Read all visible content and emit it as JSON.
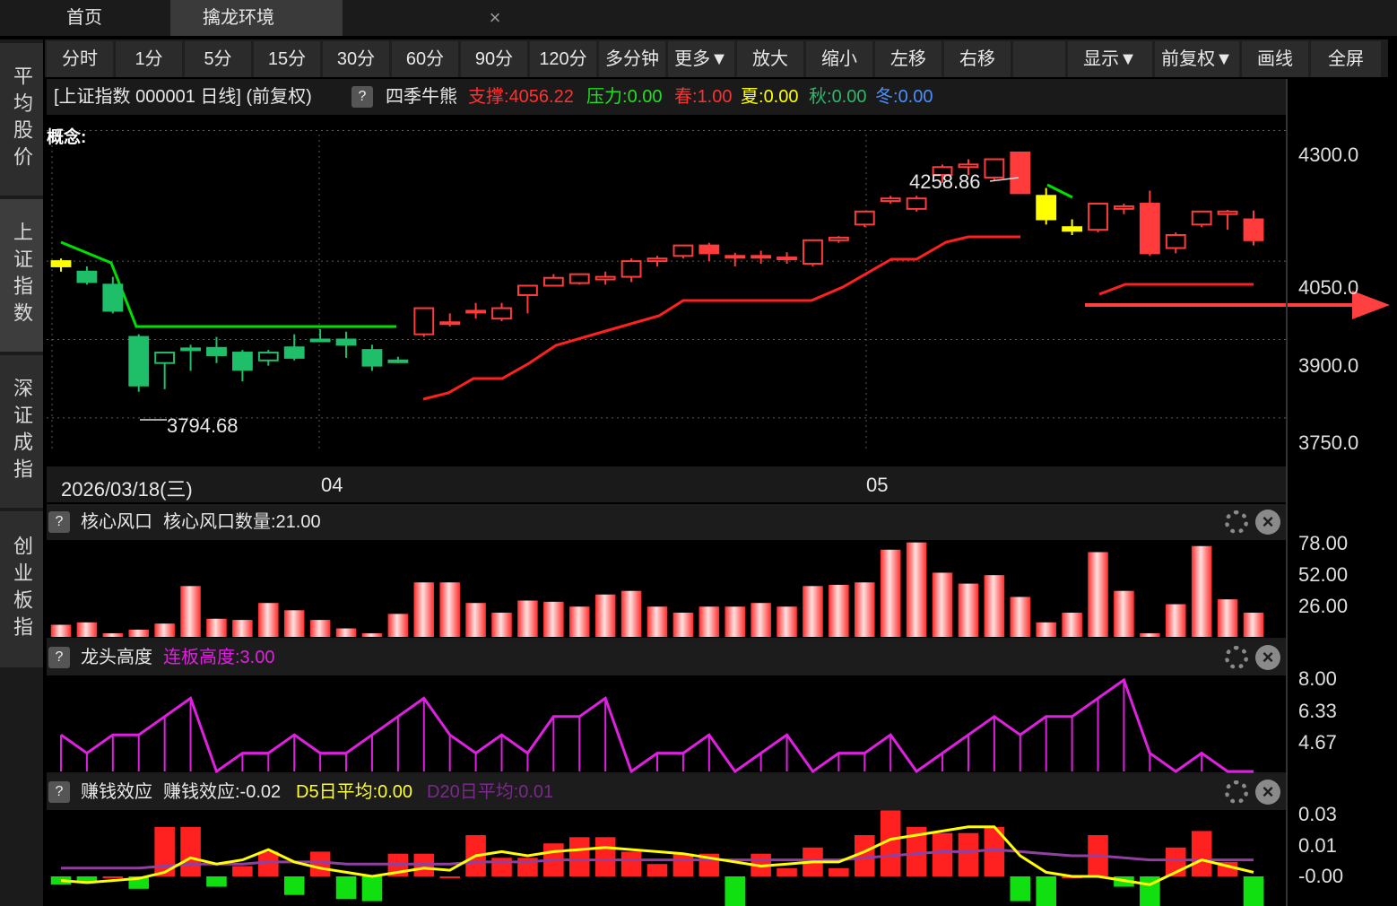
{
  "window_tabs": {
    "home": "首页",
    "active": "擒龙环境",
    "close": "×"
  },
  "sidebar": {
    "items": [
      {
        "label": "平均股价",
        "active": false
      },
      {
        "label": "上证指数",
        "active": true
      },
      {
        "label": "深证成指",
        "active": false
      },
      {
        "label": "创业板指",
        "active": false
      }
    ]
  },
  "toolbar": {
    "buttons": [
      "分时",
      "1分",
      "5分",
      "15分",
      "30分",
      "60分",
      "90分",
      "120分",
      "多分钟",
      "更多▼",
      "放大",
      "缩小",
      "左移",
      "右移",
      "",
      "显示▼",
      "前复权▼",
      "画线",
      "全屏"
    ]
  },
  "main_chart": {
    "header": {
      "title": "[上证指数 000001 日线] (前复权)",
      "help": "?",
      "indicator": "四季牛熊",
      "support_label": "支撑:",
      "support_value": "4056.22",
      "pressure_label": "压力:",
      "pressure_value": "0.00",
      "spring_label": "春:",
      "spring_value": "1.00",
      "summer_label": "夏:",
      "summer_value": "0.00",
      "autumn_label": "秋:",
      "autumn_value": "0.00",
      "winter_label": "冬:",
      "winter_value": "0.00"
    },
    "concept_label": "概念:",
    "high_marker": "4258.86",
    "low_marker": "3794.68",
    "date_label": "2026/03/18(三)",
    "month_labels": [
      "04",
      "05"
    ],
    "y_axis": [
      "4300.0",
      "4050.0",
      "3900.0",
      "3750.0"
    ]
  },
  "panels": [
    {
      "help": "?",
      "name": "核心风口",
      "value_label": "核心风口数量:21.00",
      "y_axis": [
        "78.00",
        "52.00",
        "26.00"
      ]
    },
    {
      "help": "?",
      "name": "龙头高度",
      "value_label": "连板高度:3.00",
      "y_axis": [
        "8.00",
        "6.33",
        "4.67"
      ]
    },
    {
      "help": "?",
      "name": "赚钱效应",
      "value_label": "赚钱效应:-0.02",
      "d5_label": "D5日平均:0.00",
      "d20_label": "D20日平均:0.01",
      "y_axis": [
        "0.03",
        "0.01",
        "-0.00"
      ]
    }
  ],
  "colors": {
    "up": "#ff3b3b",
    "down": "#1fbf6a",
    "green_line": "#00e000",
    "red_line": "#ff2020",
    "magenta": "#e020e0",
    "yellow": "#ffff00",
    "purple": "#9040a0"
  },
  "chart_data": [
    {
      "type": "candlestick",
      "title": "[上证指数 000001 日线] (前复权)",
      "y_range": [
        3700,
        4330
      ],
      "candles": [
        {
          "o": 4050,
          "h": 4055,
          "l": 4030,
          "c": 4040,
          "color": "yellow"
        },
        {
          "o": 4030,
          "h": 4040,
          "l": 4005,
          "c": 4010,
          "color": "green"
        },
        {
          "o": 4005,
          "h": 4020,
          "l": 3950,
          "c": 3955,
          "color": "green"
        },
        {
          "o": 3905,
          "h": 3910,
          "l": 3800,
          "c": 3812,
          "color": "green"
        },
        {
          "o": 3855,
          "h": 3875,
          "l": 3805,
          "c": 3875,
          "color": "green"
        },
        {
          "o": 3883,
          "h": 3890,
          "l": 3840,
          "c": 3883,
          "color": "green"
        },
        {
          "o": 3884,
          "h": 3905,
          "l": 3855,
          "c": 3870,
          "color": "green"
        },
        {
          "o": 3875,
          "h": 3880,
          "l": 3820,
          "c": 3842,
          "color": "green"
        },
        {
          "o": 3860,
          "h": 3880,
          "l": 3850,
          "c": 3875,
          "color": "green"
        },
        {
          "o": 3885,
          "h": 3910,
          "l": 3860,
          "c": 3865,
          "color": "green"
        },
        {
          "o": 3900,
          "h": 3920,
          "l": 3895,
          "c": 3900,
          "color": "green"
        },
        {
          "o": 3900,
          "h": 3915,
          "l": 3865,
          "c": 3890,
          "color": "green"
        },
        {
          "o": 3880,
          "h": 3890,
          "l": 3840,
          "c": 3850,
          "color": "green"
        },
        {
          "o": 3860,
          "h": 3867,
          "l": 3855,
          "c": 3860,
          "color": "green"
        },
        {
          "o": 3910,
          "h": 3960,
          "l": 3905,
          "c": 3960,
          "color": "red"
        },
        {
          "o": 3933,
          "h": 3950,
          "l": 3925,
          "c": 3933,
          "color": "red"
        },
        {
          "o": 3955,
          "h": 3970,
          "l": 3940,
          "c": 3955,
          "color": "red"
        },
        {
          "o": 3940,
          "h": 3970,
          "l": 3935,
          "c": 3960,
          "color": "red"
        },
        {
          "o": 3985,
          "h": 4000,
          "l": 3950,
          "c": 4003,
          "color": "red"
        },
        {
          "o": 4003,
          "h": 4025,
          "l": 4003,
          "c": 4018,
          "color": "red"
        },
        {
          "o": 4008,
          "h": 4025,
          "l": 4005,
          "c": 4025,
          "color": "red"
        },
        {
          "o": 4015,
          "h": 4030,
          "l": 4005,
          "c": 4020,
          "color": "red"
        },
        {
          "o": 4020,
          "h": 4055,
          "l": 4010,
          "c": 4050,
          "color": "red"
        },
        {
          "o": 4050,
          "h": 4060,
          "l": 4040,
          "c": 4055,
          "color": "red"
        },
        {
          "o": 4060,
          "h": 4080,
          "l": 4055,
          "c": 4080,
          "color": "red"
        },
        {
          "o": 4080,
          "h": 4085,
          "l": 4050,
          "c": 4065,
          "color": "red"
        },
        {
          "o": 4058,
          "h": 4066,
          "l": 4040,
          "c": 4060,
          "color": "red"
        },
        {
          "o": 4058,
          "h": 4070,
          "l": 4045,
          "c": 4060,
          "color": "red"
        },
        {
          "o": 4057,
          "h": 4067,
          "l": 4045,
          "c": 4055,
          "color": "red"
        },
        {
          "o": 4045,
          "h": 4090,
          "l": 4040,
          "c": 4090,
          "color": "red"
        },
        {
          "o": 4090,
          "h": 4098,
          "l": 4085,
          "c": 4095,
          "color": "red"
        },
        {
          "o": 4120,
          "h": 4145,
          "l": 4115,
          "c": 4145,
          "color": "red"
        },
        {
          "o": 4165,
          "h": 4175,
          "l": 4160,
          "c": 4170,
          "color": "red"
        },
        {
          "o": 4150,
          "h": 4175,
          "l": 4145,
          "c": 4170,
          "color": "red"
        },
        {
          "o": 4215,
          "h": 4235,
          "l": 4200,
          "c": 4230,
          "color": "red"
        },
        {
          "o": 4230,
          "h": 4245,
          "l": 4215,
          "c": 4235,
          "color": "red"
        },
        {
          "o": 4210,
          "h": 4245,
          "l": 4205,
          "c": 4245,
          "color": "red"
        },
        {
          "o": 4258,
          "h": 4259,
          "l": 4180,
          "c": 4180,
          "color": "red"
        },
        {
          "o": 4175,
          "h": 4190,
          "l": 4120,
          "c": 4130,
          "color": "yellow"
        },
        {
          "o": 4115,
          "h": 4130,
          "l": 4100,
          "c": 4108,
          "color": "yellow"
        },
        {
          "o": 4110,
          "h": 4160,
          "l": 4105,
          "c": 4160,
          "color": "red"
        },
        {
          "o": 4150,
          "h": 4160,
          "l": 4140,
          "c": 4155,
          "color": "red"
        },
        {
          "o": 4160,
          "h": 4185,
          "l": 4060,
          "c": 4065,
          "color": "red"
        },
        {
          "o": 4075,
          "h": 4105,
          "l": 4065,
          "c": 4100,
          "color": "red"
        },
        {
          "o": 4120,
          "h": 4145,
          "l": 4115,
          "c": 4145,
          "color": "red"
        },
        {
          "o": 4140,
          "h": 4148,
          "l": 4110,
          "c": 4145,
          "color": "red"
        },
        {
          "o": 4130,
          "h": 4147,
          "l": 4080,
          "c": 4090,
          "color": "red"
        }
      ],
      "annotations": [
        {
          "text": "4258.86"
        },
        {
          "text": "3794.68"
        }
      ]
    },
    {
      "type": "bar",
      "title": "核心风口",
      "ylim": [
        0,
        80
      ],
      "values": [
        10,
        12,
        3,
        6,
        11,
        42,
        15,
        14,
        28,
        22,
        14,
        7,
        3,
        19,
        45,
        45,
        28,
        20,
        30,
        29,
        25,
        35,
        38,
        25,
        20,
        25,
        25,
        28,
        25,
        42,
        43,
        45,
        72,
        78,
        53,
        44,
        51,
        33,
        12,
        20,
        70,
        38,
        3,
        27,
        75,
        31,
        20
      ]
    },
    {
      "type": "line",
      "title": "龙头高度",
      "ylim": [
        3,
        8
      ],
      "values": [
        5,
        4,
        5,
        5,
        6,
        7,
        3,
        4,
        4,
        5,
        4,
        4,
        5,
        6,
        7,
        5,
        4,
        5,
        4,
        6,
        6,
        7,
        3,
        4,
        4,
        5,
        3,
        4,
        5,
        3,
        4,
        4,
        5,
        3,
        4,
        5,
        6,
        5,
        6,
        6,
        7,
        8,
        4,
        3,
        4,
        3,
        3
      ]
    },
    {
      "type": "bar+line",
      "title": "赚钱效应",
      "ylim": [
        -0.01,
        0.03
      ],
      "series": [
        {
          "name": "赚钱效应",
          "values": [
            -0.004,
            -0.003,
            0.0,
            -0.006,
            0.024,
            0.024,
            -0.005,
            0.005,
            0.012,
            -0.009,
            0.012,
            -0.011,
            -0.012,
            0.011,
            0.011,
            0.0,
            0.02,
            0.009,
            0.009,
            0.016,
            0.019,
            0.019,
            0.012,
            0.006,
            0.011,
            0.011,
            -0.017,
            0.011,
            0.004,
            0.014,
            0.004,
            0.02,
            0.032,
            0.024,
            0.021,
            0.021,
            0.024,
            -0.012,
            -0.02,
            0.0,
            0.02,
            -0.005,
            -0.015,
            0.014,
            0.022,
            0.007,
            -0.019
          ]
        },
        {
          "name": "D5日平均",
          "values": [
            -0.002,
            -0.003,
            -0.002,
            -0.001,
            0.002,
            0.009,
            0.006,
            0.008,
            0.013,
            0.007,
            0.004,
            0.002,
            0.0,
            0.002,
            0.004,
            0.003,
            0.01,
            0.012,
            0.01,
            0.012,
            0.013,
            0.014,
            0.013,
            0.012,
            0.011,
            0.009,
            0.007,
            0.005,
            0.006,
            0.007,
            0.007,
            0.012,
            0.018,
            0.02,
            0.022,
            0.024,
            0.024,
            0.01,
            0.002,
            0.0,
            0.0,
            -0.002,
            -0.004,
            0.002,
            0.008,
            0.005,
            0.002
          ]
        },
        {
          "name": "D20日平均",
          "values": [
            0.004,
            0.004,
            0.004,
            0.004,
            0.005,
            0.006,
            0.006,
            0.006,
            0.007,
            0.007,
            0.007,
            0.006,
            0.006,
            0.006,
            0.006,
            0.006,
            0.007,
            0.007,
            0.007,
            0.008,
            0.008,
            0.008,
            0.008,
            0.008,
            0.008,
            0.008,
            0.008,
            0.008,
            0.008,
            0.008,
            0.008,
            0.009,
            0.01,
            0.011,
            0.012,
            0.012,
            0.013,
            0.012,
            0.011,
            0.01,
            0.01,
            0.009,
            0.008,
            0.008,
            0.008,
            0.008,
            0.008
          ]
        }
      ]
    }
  ]
}
